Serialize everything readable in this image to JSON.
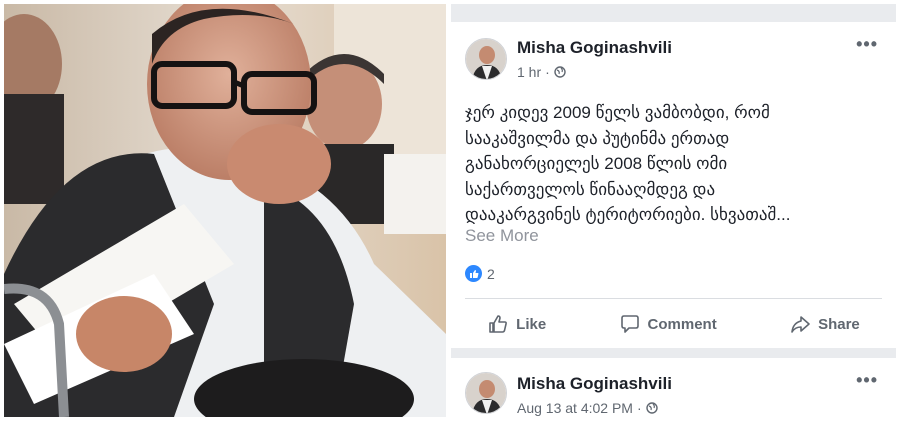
{
  "posts": [
    {
      "author": "Misha Goginashvili",
      "time": "1 hr",
      "separator": "·",
      "privacy_icon": "globe-icon",
      "text_lines": [
        "ჯერ კიდევ 2009 წელს ვამბობდი, რომ",
        "სააკაშვილმა და პუტინმა ერთად",
        "განახორციელეს 2008 წლის ომი",
        "საქართველოს წინააღმდეგ და",
        "დააკარგვინეს ტერიტორიები. სხვათაშ..."
      ],
      "see_more": "See More",
      "reaction_count": "2",
      "actions": {
        "like": "Like",
        "comment": "Comment",
        "share": "Share"
      }
    },
    {
      "author": "Misha Goginashvili",
      "time": "Aug 13 at 4:02 PM",
      "separator": "·",
      "privacy_icon": "globe-icon"
    }
  ],
  "colors": {
    "feed_background": "#e9ebee",
    "text_primary": "#1d2129",
    "text_secondary": "#606770",
    "like_blue": "#2d88ff"
  }
}
